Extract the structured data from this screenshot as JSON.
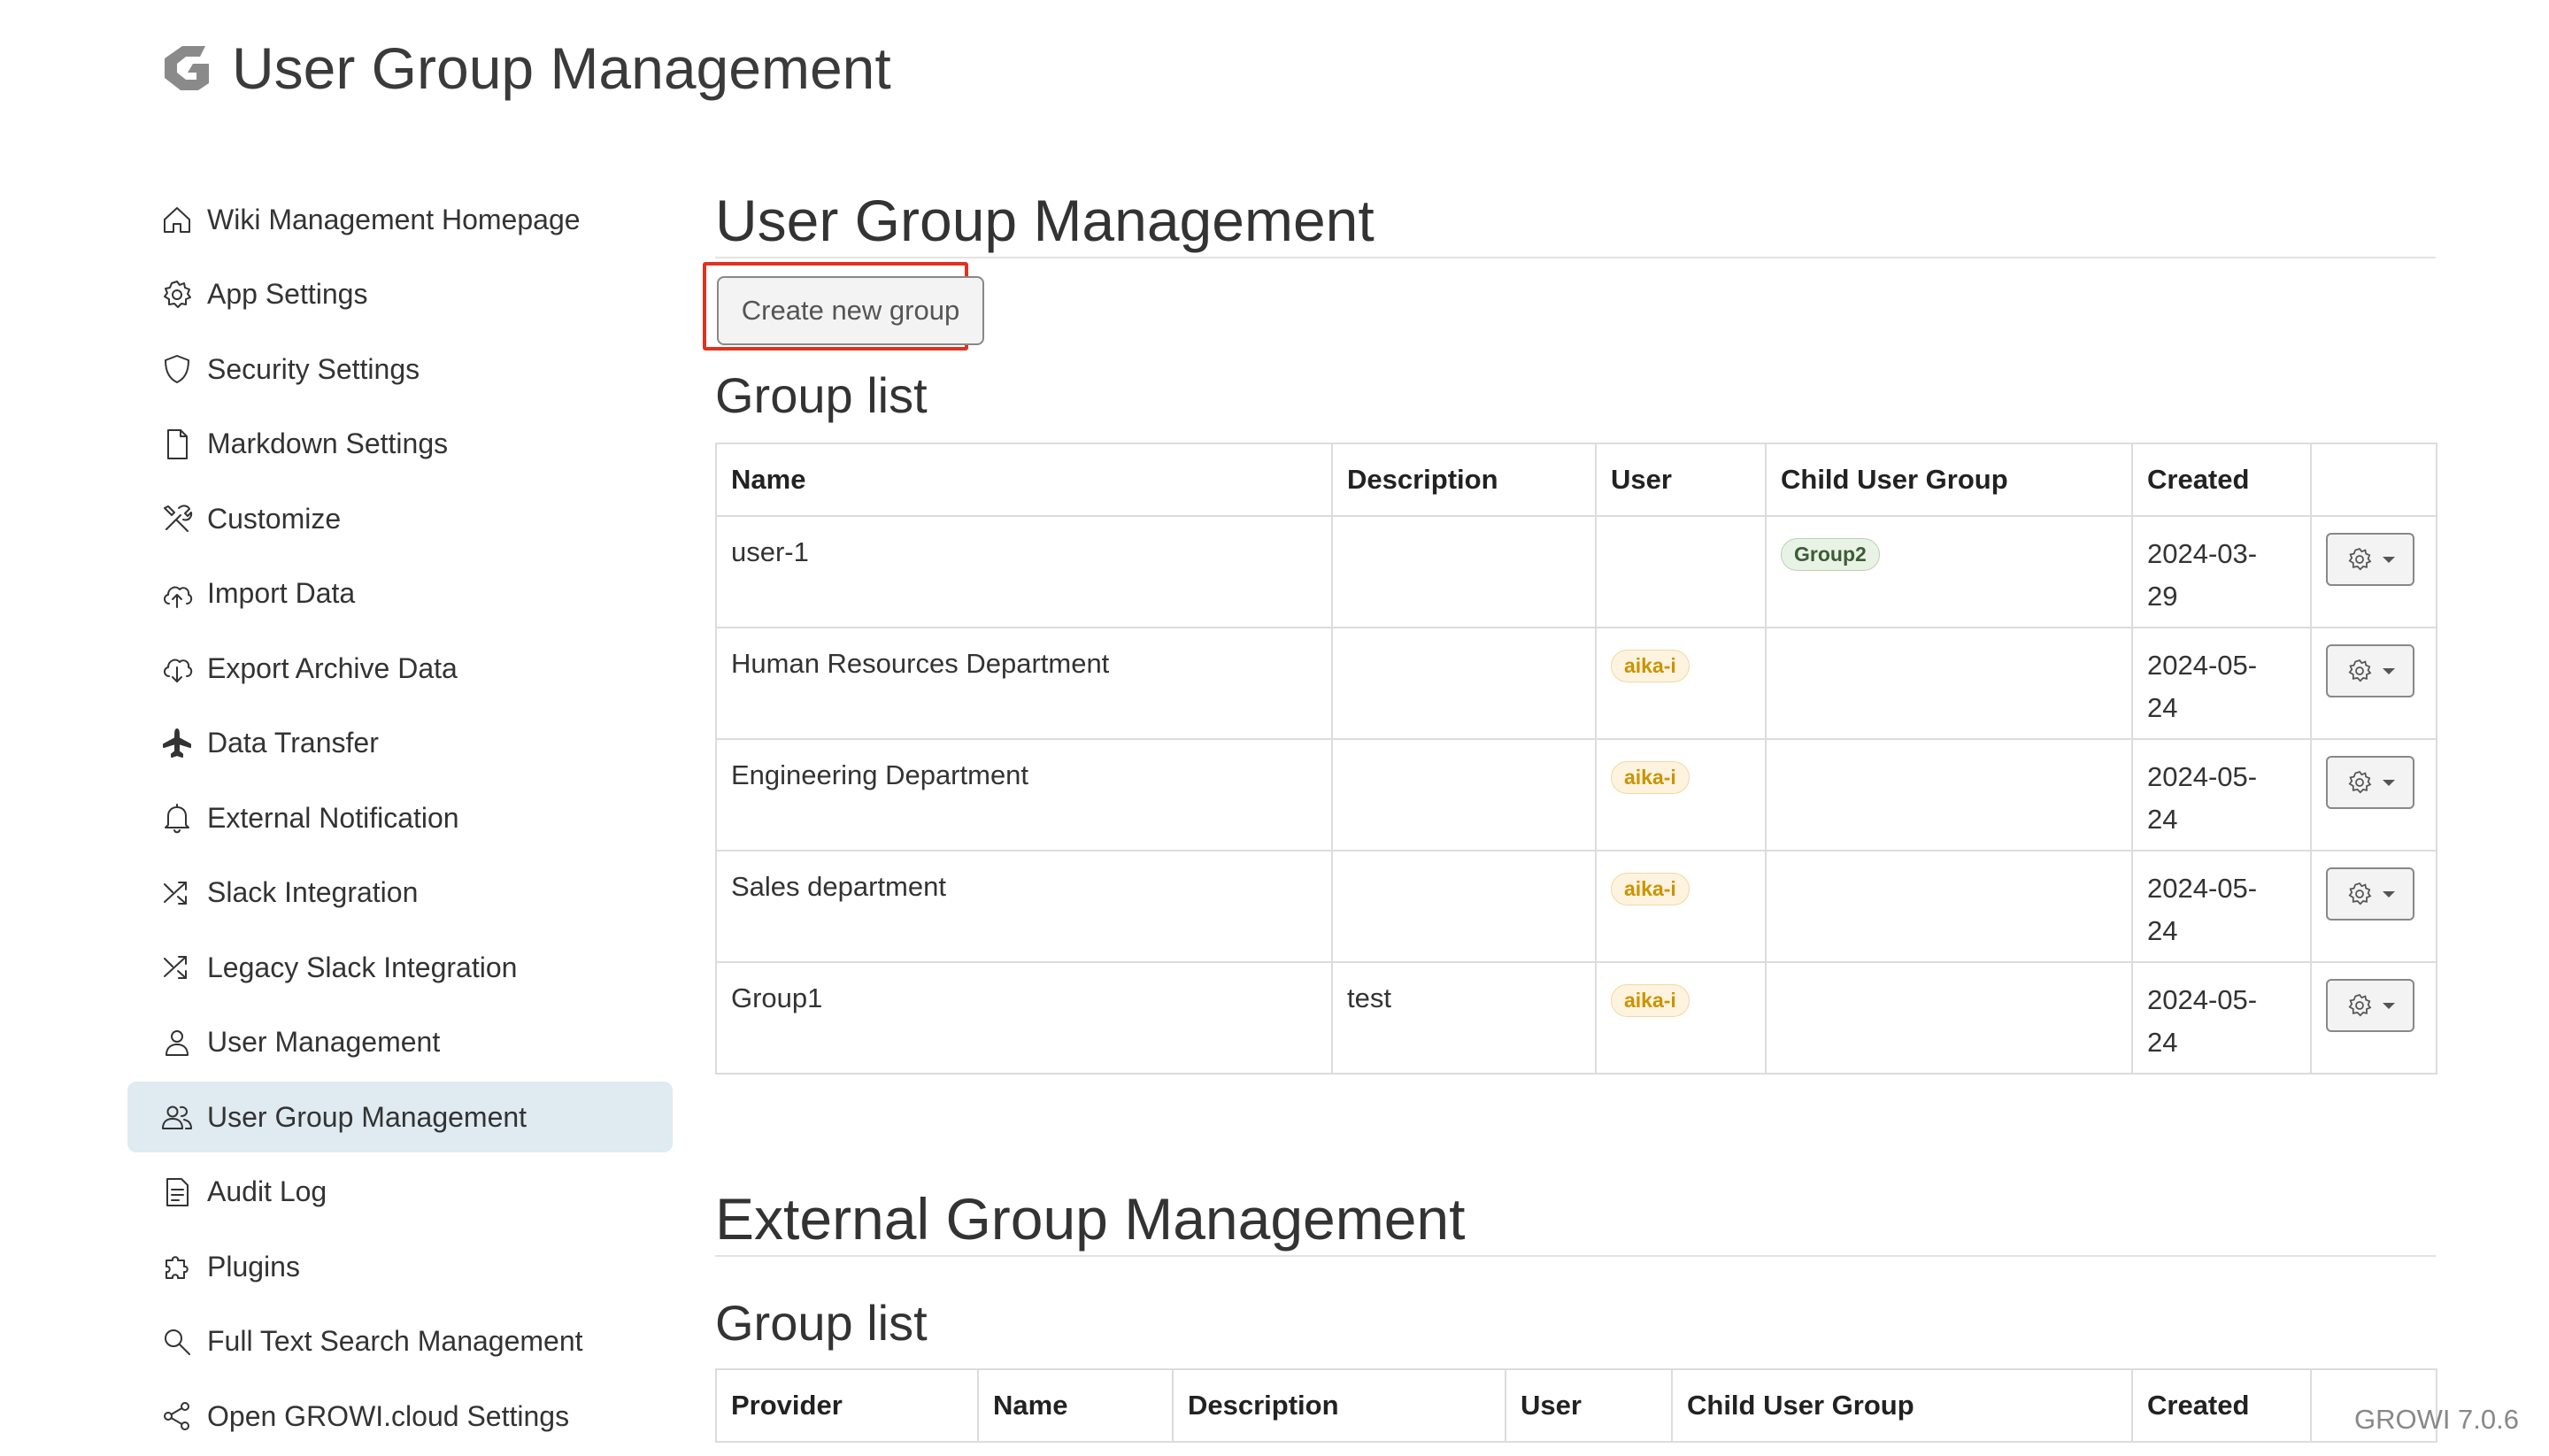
{
  "app": {
    "title": "User Group Management",
    "version": "GROWI 7.0.6"
  },
  "sidebar": {
    "items": [
      {
        "label": "Wiki Management Homepage",
        "icon": "home-icon"
      },
      {
        "label": "App Settings",
        "icon": "gear-icon"
      },
      {
        "label": "Security Settings",
        "icon": "shield-icon"
      },
      {
        "label": "Markdown Settings",
        "icon": "file-icon"
      },
      {
        "label": "Customize",
        "icon": "tools-icon"
      },
      {
        "label": "Import Data",
        "icon": "cloud-upload-icon"
      },
      {
        "label": "Export Archive Data",
        "icon": "cloud-download-icon"
      },
      {
        "label": "Data Transfer",
        "icon": "airplane-icon"
      },
      {
        "label": "External Notification",
        "icon": "bell-icon"
      },
      {
        "label": "Slack Integration",
        "icon": "shuffle-icon"
      },
      {
        "label": "Legacy Slack Integration",
        "icon": "shuffle-icon"
      },
      {
        "label": "User Management",
        "icon": "person-icon"
      },
      {
        "label": "User Group Management",
        "icon": "people-icon"
      },
      {
        "label": "Audit Log",
        "icon": "document-icon"
      },
      {
        "label": "Plugins",
        "icon": "puzzle-icon"
      },
      {
        "label": "Full Text Search Management",
        "icon": "search-icon"
      },
      {
        "label": "Open GROWI.cloud Settings",
        "icon": "share-icon"
      }
    ]
  },
  "main": {
    "title": "User Group Management",
    "create_button": "Create new group",
    "group_list_title": "Group list",
    "columns": [
      "Name",
      "Description",
      "User",
      "Child User Group",
      "Created"
    ],
    "rows": [
      {
        "name": "user-1",
        "description": "",
        "user": "",
        "child": "Group2",
        "created": "2024-03-29"
      },
      {
        "name": "Human Resources Department",
        "description": "",
        "user": "aika-i",
        "child": "",
        "created": "2024-05-24"
      },
      {
        "name": "Engineering Department",
        "description": "",
        "user": "aika-i",
        "child": "",
        "created": "2024-05-24"
      },
      {
        "name": "Sales department",
        "description": "",
        "user": "aika-i",
        "child": "",
        "created": "2024-05-24"
      },
      {
        "name": "Group1",
        "description": "test",
        "user": "aika-i",
        "child": "",
        "created": "2024-05-24"
      }
    ],
    "external": {
      "title": "External Group Management",
      "group_list_title": "Group list",
      "columns": [
        "Provider",
        "Name",
        "Description",
        "User",
        "Child User Group",
        "Created"
      ]
    }
  },
  "colors": {
    "active_nav": "#dfeaf1",
    "highlight": "#e0321f",
    "user_badge": "#fdf3df",
    "child_badge": "#e8f3e5"
  }
}
